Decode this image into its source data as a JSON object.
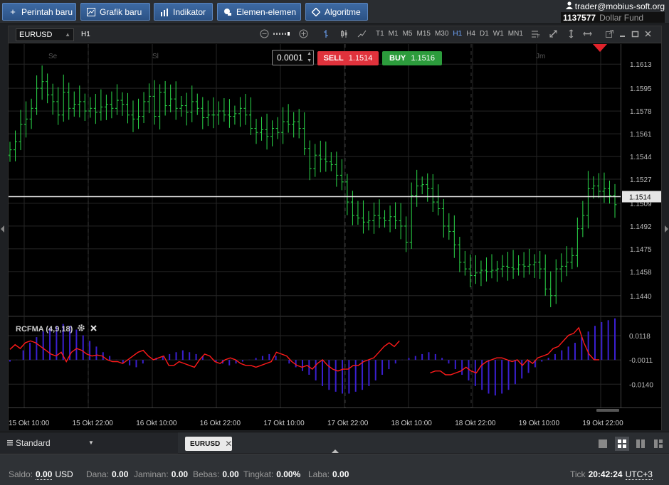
{
  "toolbar": {
    "buttons": [
      {
        "label": "Perintah baru",
        "icon": "plus-icon"
      },
      {
        "label": "Grafik baru",
        "icon": "chart-icon"
      },
      {
        "label": "Indikator",
        "icon": "bars-icon"
      },
      {
        "label": "Elemen-elemen",
        "icon": "elements-icon"
      },
      {
        "label": "Algoritme",
        "icon": "diamond-icon"
      }
    ]
  },
  "account": {
    "user": "trader@mobius-soft.org",
    "number": "1137577",
    "fund": "Dollar Fund"
  },
  "chart_window": {
    "symbol": "EURUSD",
    "timeframe": "H1",
    "timeframes": [
      "T1",
      "M1",
      "M5",
      "M15",
      "M30",
      "H1",
      "H4",
      "D1",
      "W1",
      "MN1"
    ],
    "active_timeframe": "H1"
  },
  "order": {
    "volume": "0.0001",
    "sell_label": "SELL",
    "sell_price": "1.1514",
    "buy_label": "BUY",
    "buy_price": "1.1516"
  },
  "indicator": {
    "label": "RCFMA (4,9,18)"
  },
  "colors": {
    "up": "#2bd94a",
    "ind_line": "#ff1a1a",
    "ind_hist": "#3a1fd0",
    "sell": "#e0323c",
    "buy": "#2c9c3c"
  },
  "chart_data": [
    {
      "type": "bar",
      "title": "",
      "day_labels": [
        "Se",
        "Sl",
        "Jm"
      ],
      "yticks": [
        "1.1613",
        "1.1595",
        "1.1578",
        "1.1561",
        "1.1544",
        "1.1527",
        "1.1509",
        "1.1492",
        "1.1475",
        "1.1458",
        "1.1440"
      ],
      "ylim": [
        1.1425,
        1.1628
      ],
      "current_price": "1.1514",
      "xticks": [
        "15 Okt 10:00",
        "15 Okt 22:00",
        "16 Okt 10:00",
        "16 Okt 22:00",
        "17 Okt 10:00",
        "17 Okt 22:00",
        "18 Okt 10:00",
        "18 Okt 22:00",
        "19 Okt 10:00",
        "19 Okt 22:00"
      ],
      "close": [
        1.1549,
        1.1555,
        1.1568,
        1.1572,
        1.158,
        1.1595,
        1.16,
        1.159,
        1.1585,
        1.1575,
        1.1592,
        1.158,
        1.1583,
        1.1585,
        1.1578,
        1.158,
        1.1577,
        1.1581,
        1.1583,
        1.158,
        1.1586,
        1.1583,
        1.1575,
        1.1572,
        1.1574,
        1.1585,
        1.1589,
        1.1574,
        1.1592,
        1.1582,
        1.1587,
        1.158,
        1.1582,
        1.1577,
        1.1585,
        1.158,
        1.1573,
        1.1575,
        1.1575,
        1.1578,
        1.1575,
        1.1574,
        1.1576,
        1.158,
        1.1575,
        1.1565,
        1.1562,
        1.1564,
        1.1559,
        1.1565,
        1.1562,
        1.157,
        1.1568,
        1.157,
        1.1565,
        1.155,
        1.1535,
        1.1545,
        1.1542,
        1.154,
        1.1538,
        1.153,
        1.1525,
        1.151,
        1.15,
        1.1498,
        1.1495,
        1.1496,
        1.15,
        1.1498,
        1.1496,
        1.1499,
        1.1496,
        1.1492,
        1.148,
        1.1515,
        1.1522,
        1.1523,
        1.152,
        1.151,
        1.1505,
        1.1492,
        1.1488,
        1.1478,
        1.1465,
        1.146,
        1.1455,
        1.1457,
        1.1459,
        1.1458,
        1.1459,
        1.146,
        1.1462,
        1.1461,
        1.146,
        1.1463,
        1.1462,
        1.1463,
        1.1465,
        1.146,
        1.1445,
        1.144,
        1.146,
        1.1462,
        1.1465,
        1.147,
        1.149,
        1.15,
        1.152,
        1.1522,
        1.1518,
        1.152,
        1.1515,
        1.1508
      ],
      "indicator": {
        "name": "RCFMA (4,9,18)",
        "yticks": [
          "0.0118",
          "-0.0011",
          "-0.0140"
        ],
        "ylim": [
          -0.026,
          0.022
        ],
        "line": [
          0.0045,
          0.007,
          0.005,
          0.008,
          0.009,
          0.008,
          0.006,
          0.004,
          0.002,
          0.001,
          0.003,
          -0.002,
          0.003,
          0.005,
          0.004,
          0.002,
          0.001,
          0.0015,
          0.001,
          -0.001,
          -0.002,
          -0.002,
          -0.003,
          -0.001,
          0.001,
          0.003,
          0.004,
          0.001,
          -0.001,
          0.0,
          0.001,
          -0.004,
          -0.004,
          -0.002,
          -0.003,
          -0.004,
          -0.005,
          -0.001,
          0.002,
          0.001,
          -0.002,
          -0.003,
          -0.001,
          0.0,
          -0.001,
          -0.003,
          -0.004,
          -0.004,
          -0.005,
          -0.004,
          -0.003,
          -0.002,
          0.003,
          0.002,
          0.001,
          -0.002,
          -0.004,
          -0.005,
          -0.004,
          -0.006,
          -0.003,
          -0.001,
          -0.004,
          -0.006,
          -0.007,
          -0.006,
          -0.006,
          -0.004,
          -0.004,
          -0.002,
          -0.001,
          0.0,
          0.003,
          0.006,
          0.008,
          0.006,
          0.009,
          null,
          null,
          null,
          null,
          null,
          -0.008,
          -0.007,
          -0.007,
          -0.009,
          -0.009,
          -0.008,
          -0.007,
          -0.005,
          -0.007,
          -0.008,
          -0.004,
          -0.002,
          -0.001,
          0.0,
          0.0,
          -0.001,
          -0.002,
          -0.001,
          -0.004,
          -0.001,
          -0.003,
          0.0,
          0.001,
          0.002,
          0.005,
          0.006,
          0.009,
          0.012,
          0.013,
          0.016,
          0.008,
          0.002,
          -0.001,
          -0.001
        ],
        "hist": [
          -0.002,
          -0.001,
          0.004,
          0.008,
          0.011,
          0.014,
          0.016,
          0.017,
          0.018,
          0.017,
          0.015,
          0.012,
          0.009,
          0.006,
          0.003,
          0.001,
          -0.001,
          -0.003,
          -0.004,
          -0.005,
          -0.003,
          -0.001,
          0.0,
          0.001,
          0.002,
          0.003,
          0.004,
          0.003,
          0.002,
          0.001,
          -0.001,
          -0.002,
          -0.003,
          -0.004,
          -0.003,
          -0.002,
          -0.001,
          0.0,
          0.001,
          0.002,
          0.001,
          -0.001,
          -0.003,
          -0.005,
          -0.007,
          -0.009,
          -0.012,
          -0.015,
          -0.017,
          -0.018,
          -0.019,
          -0.019,
          -0.018,
          -0.017,
          -0.015,
          -0.012,
          -0.009,
          -0.006,
          -0.003,
          -0.001,
          0.0,
          0.001,
          0.002,
          0.003,
          0.002,
          0.0,
          -0.003,
          -0.006,
          -0.009,
          -0.012,
          -0.015,
          -0.017,
          -0.019,
          -0.02,
          -0.019,
          -0.017,
          -0.014,
          -0.011,
          -0.008,
          -0.005,
          -0.002,
          0.0,
          0.002,
          0.004,
          0.006,
          0.008,
          0.011,
          0.014,
          0.017,
          0.019,
          0.02,
          0.021
        ]
      }
    }
  ],
  "tabs": {
    "layout": "Standard",
    "symbol_tab": "EURUSD"
  },
  "status": {
    "saldo_label": "Saldo:",
    "saldo": "0.00",
    "saldo_cur": "USD",
    "dana_label": "Dana:",
    "dana": "0.00",
    "jaminan_label": "Jaminan:",
    "jaminan": "0.00",
    "bebas_label": "Bebas:",
    "bebas": "0.00",
    "tingkat_label": "Tingkat:",
    "tingkat": "0.00%",
    "laba_label": "Laba:",
    "laba": "0.00",
    "tick_label": "Tick",
    "time": "20:42:24",
    "tz": "UTC+3"
  }
}
